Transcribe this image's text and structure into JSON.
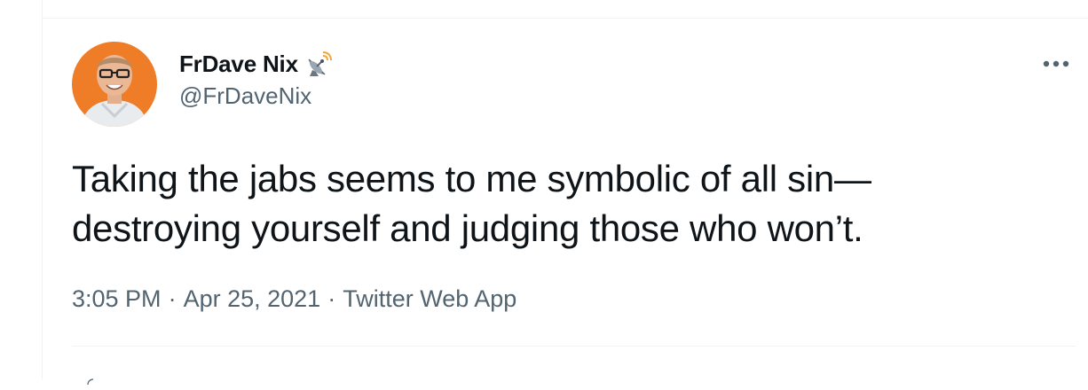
{
  "tweet": {
    "author": {
      "display_name": "FrDave Nix",
      "handle": "@FrDaveNix",
      "badge_icon": "satellite-icon",
      "avatar_bg": "#ef7d27"
    },
    "text": "Taking the jabs seems to me symbolic of all sin—\ndestroying yourself and judging those who won’t.",
    "time": "3:05 PM",
    "date": "Apr 25, 2021",
    "source": "Twitter Web App",
    "separator": "·",
    "more_icon": "more-horizontal-icon"
  },
  "colors": {
    "text_primary": "#0f1419",
    "text_secondary": "#536471",
    "divider": "#eff3f4"
  }
}
